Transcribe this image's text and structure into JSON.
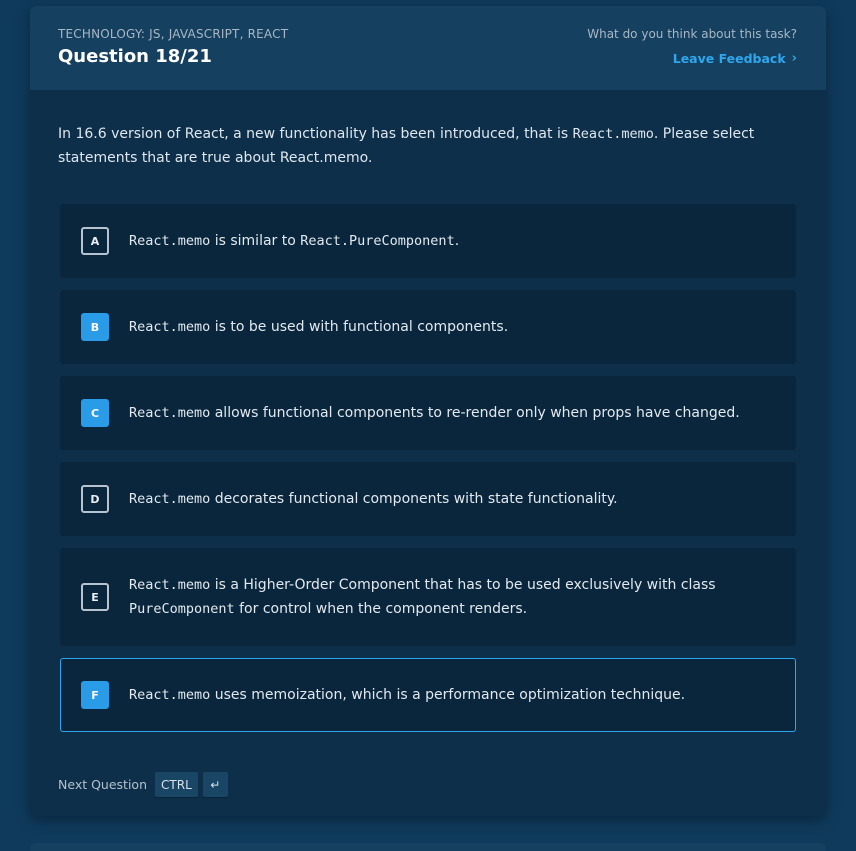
{
  "header": {
    "technology": "TECHNOLOGY: JS, JAVASCRIPT, REACT",
    "question_number": "Question 18/21",
    "feedback_prompt": "What do you think about this task?",
    "feedback_link": "Leave Feedback"
  },
  "question": {
    "prefix": "In 16.6 version of React, a new functionality has been introduced, that is ",
    "code": "React.memo",
    "suffix": ". Please select statements that are true about React.memo."
  },
  "options": [
    {
      "letter": "A",
      "checked": false,
      "code": "React.memo",
      "text": " is similar to ",
      "code2": "React.PureComponent",
      "text2": "."
    },
    {
      "letter": "B",
      "checked": true,
      "code": "React.memo",
      "text": " is to be used with functional components."
    },
    {
      "letter": "C",
      "checked": true,
      "code": "React.memo",
      "text": " allows functional components to re-render only when props have changed."
    },
    {
      "letter": "D",
      "checked": false,
      "code": "React.memo",
      "text": " decorates functional components with state functionality."
    },
    {
      "letter": "E",
      "checked": false,
      "code": "React.memo",
      "text": " is a Higher-Order Component that has to be used exclusively with class ",
      "code2": "PureComponent",
      "text2": " for control when the component renders."
    },
    {
      "letter": "F",
      "checked": true,
      "code": "React.memo",
      "text": " uses memoization, which is a performance optimization technique."
    }
  ],
  "footer": {
    "next_label": "Next Question",
    "key_ctrl": "CTRL",
    "key_enter": "↵"
  },
  "colors": {
    "accent": "#2ea7ee",
    "background": "#0f3a5c",
    "card": "#0d2f4a",
    "option": "#0a263c"
  }
}
